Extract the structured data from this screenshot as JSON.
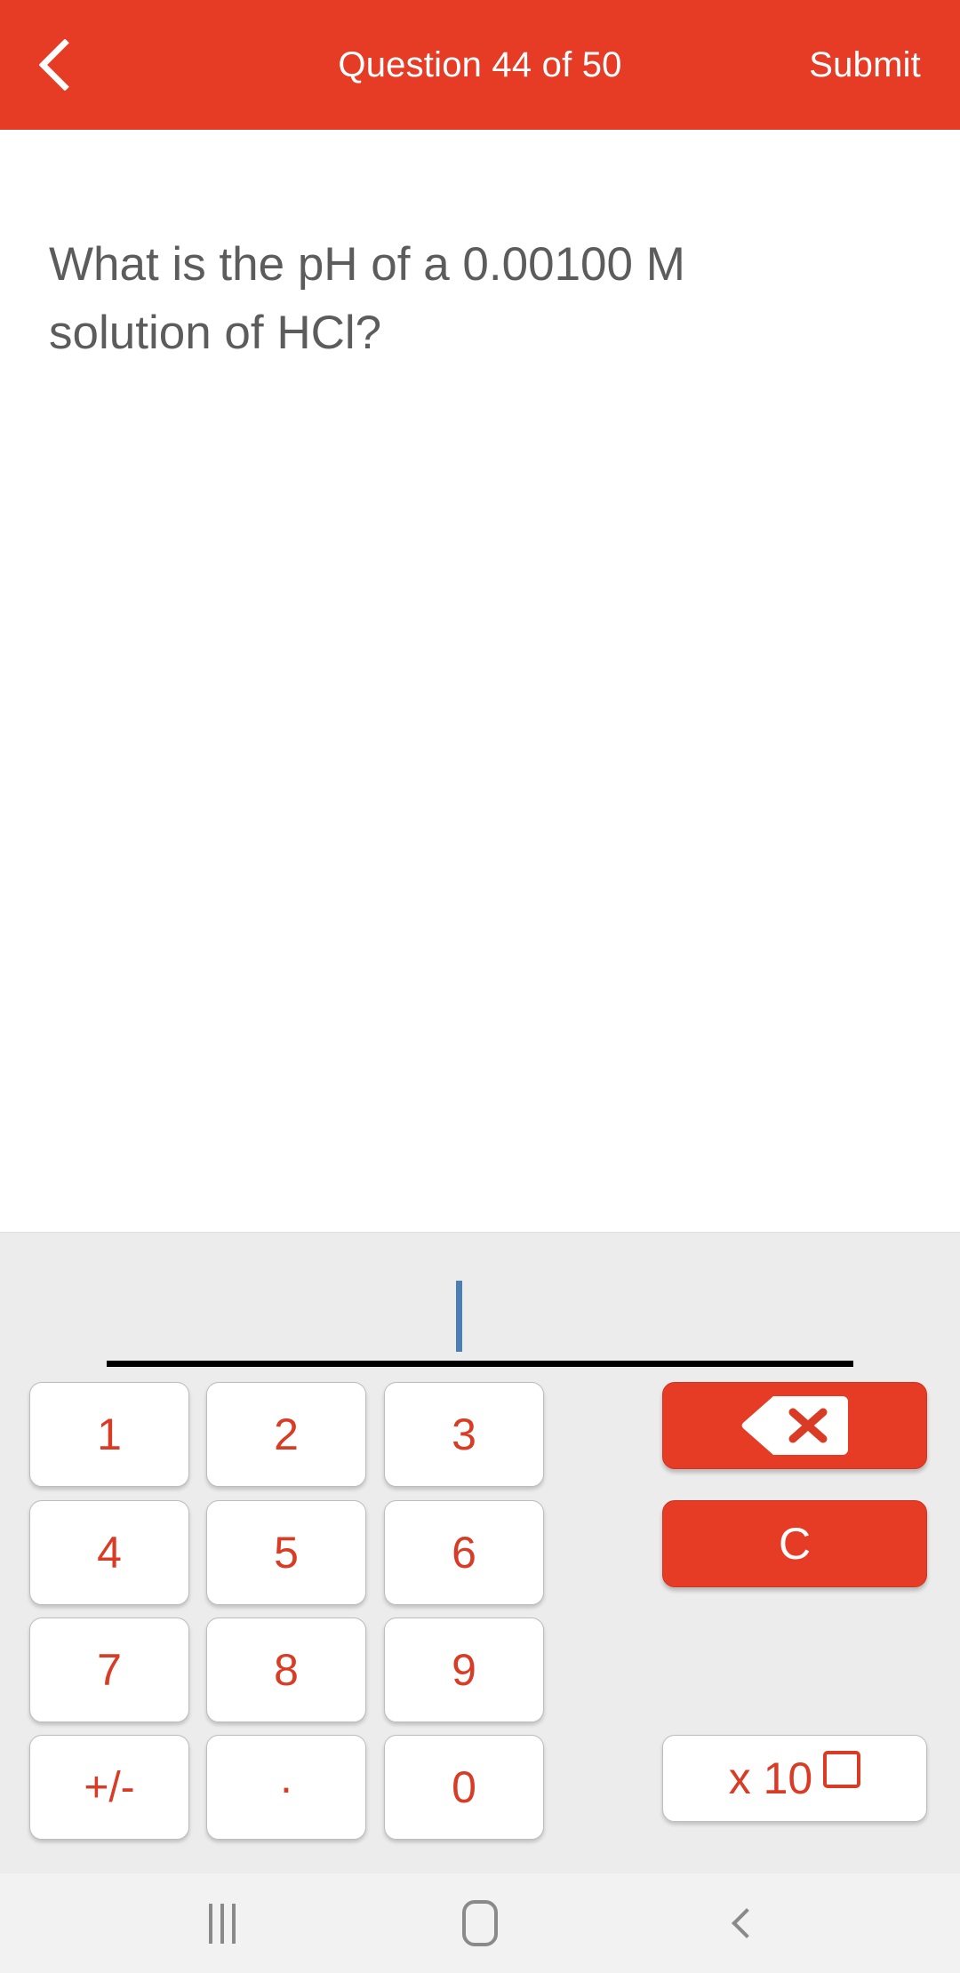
{
  "header": {
    "back_icon": "chevron-left-icon",
    "title": "Question 44 of 50",
    "submit_label": "Submit",
    "background_color": "#e63c26",
    "text_color": "#ffffff"
  },
  "question": {
    "text": "What is the pH of a 0.00100 M solution of HCl?",
    "text_color": "#5c5c5c"
  },
  "answer_input": {
    "value": "",
    "caret_visible": true,
    "caret_color": "#4a7eb5",
    "underline_color": "#000000"
  },
  "keypad": {
    "background_color": "#ececec",
    "key_text_color": "#d93b25",
    "accent_color": "#e63c26",
    "number_keys": [
      {
        "label": "1",
        "name": "key-1"
      },
      {
        "label": "2",
        "name": "key-2"
      },
      {
        "label": "3",
        "name": "key-3"
      },
      {
        "label": "4",
        "name": "key-4"
      },
      {
        "label": "5",
        "name": "key-5"
      },
      {
        "label": "6",
        "name": "key-6"
      },
      {
        "label": "7",
        "name": "key-7"
      },
      {
        "label": "8",
        "name": "key-8"
      },
      {
        "label": "9",
        "name": "key-9"
      },
      {
        "label": "+/-",
        "name": "key-plus-minus"
      },
      {
        "label": ".",
        "name": "key-decimal"
      },
      {
        "label": "0",
        "name": "key-0"
      }
    ],
    "backspace": {
      "label": "",
      "icon": "backspace-icon"
    },
    "clear": {
      "label": "C"
    },
    "exponent": {
      "label": "x 10",
      "exponent_placeholder": ""
    }
  },
  "navbar": {
    "recents_icon": "recents-icon",
    "home_icon": "home-icon",
    "back_icon": "back-icon",
    "background_color": "#f2f2f2",
    "icon_color": "#8a8a8a"
  }
}
